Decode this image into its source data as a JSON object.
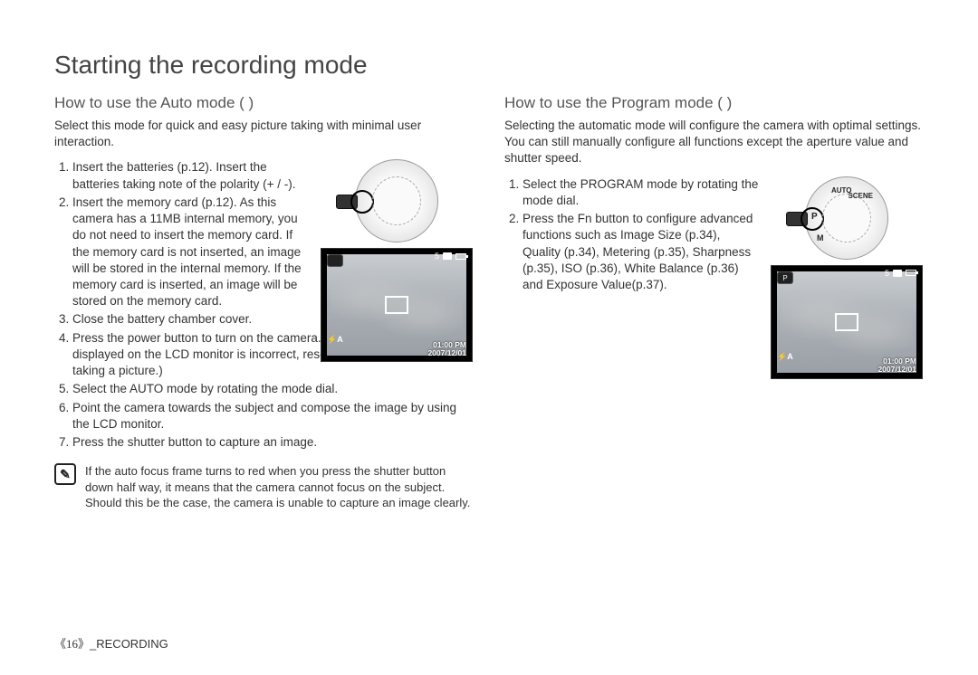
{
  "title": "Starting the recording mode",
  "auto": {
    "heading": "How to use the Auto mode (          )",
    "intro": "Select this mode for quick and easy picture taking with minimal user interaction.",
    "steps": [
      "Insert the batteries (p.12). Insert the batteries taking note of the polarity (+ / -).",
      "Insert the memory card (p.12). As this camera has a 11MB internal memory, you do not need to insert the memory card. If the memory card is not inserted, an image will be stored in the internal memory. If the memory card is inserted, an image will be stored on the memory card.",
      "Close the battery chamber cover.",
      "Press the power button to turn on the camera. (If the date/time that is displayed on the LCD monitor is incorrect, reset the date/time before taking a picture.)",
      "Select the AUTO mode by rotating the mode dial.",
      "Point the camera towards the subject and compose the image by using the LCD monitor.",
      "Press the shutter button to capture an image."
    ],
    "note": "If the auto focus frame turns to red when you press the shutter button down half way, it means that the camera cannot focus on the subject. Should this be the case, the camera is unable to capture an image clearly."
  },
  "program": {
    "heading": "How to use the Program mode (     )",
    "intro": "Selecting the automatic mode will conﬁgure the camera with optimal settings. You can still manually conﬁgure all functions except the aperture value and shutter speed.",
    "steps": [
      "Select the PROGRAM mode by rotating the mode dial.",
      "Press the Fn button to conﬁgure advanced functions such as Image Size (p.34), Quality (p.34), Metering (p.35), Sharpness (p.35), ISO (p.36), White Balance (p.36) and Exposure Value(p.37)."
    ],
    "dial_letter": "P"
  },
  "lcd": {
    "count": "5",
    "time": "01:00 PM",
    "date": "2007/12/01"
  },
  "footer": {
    "page": "《16》",
    "section": "_RECORDING"
  },
  "icons": {
    "note_glyph": "✎"
  }
}
